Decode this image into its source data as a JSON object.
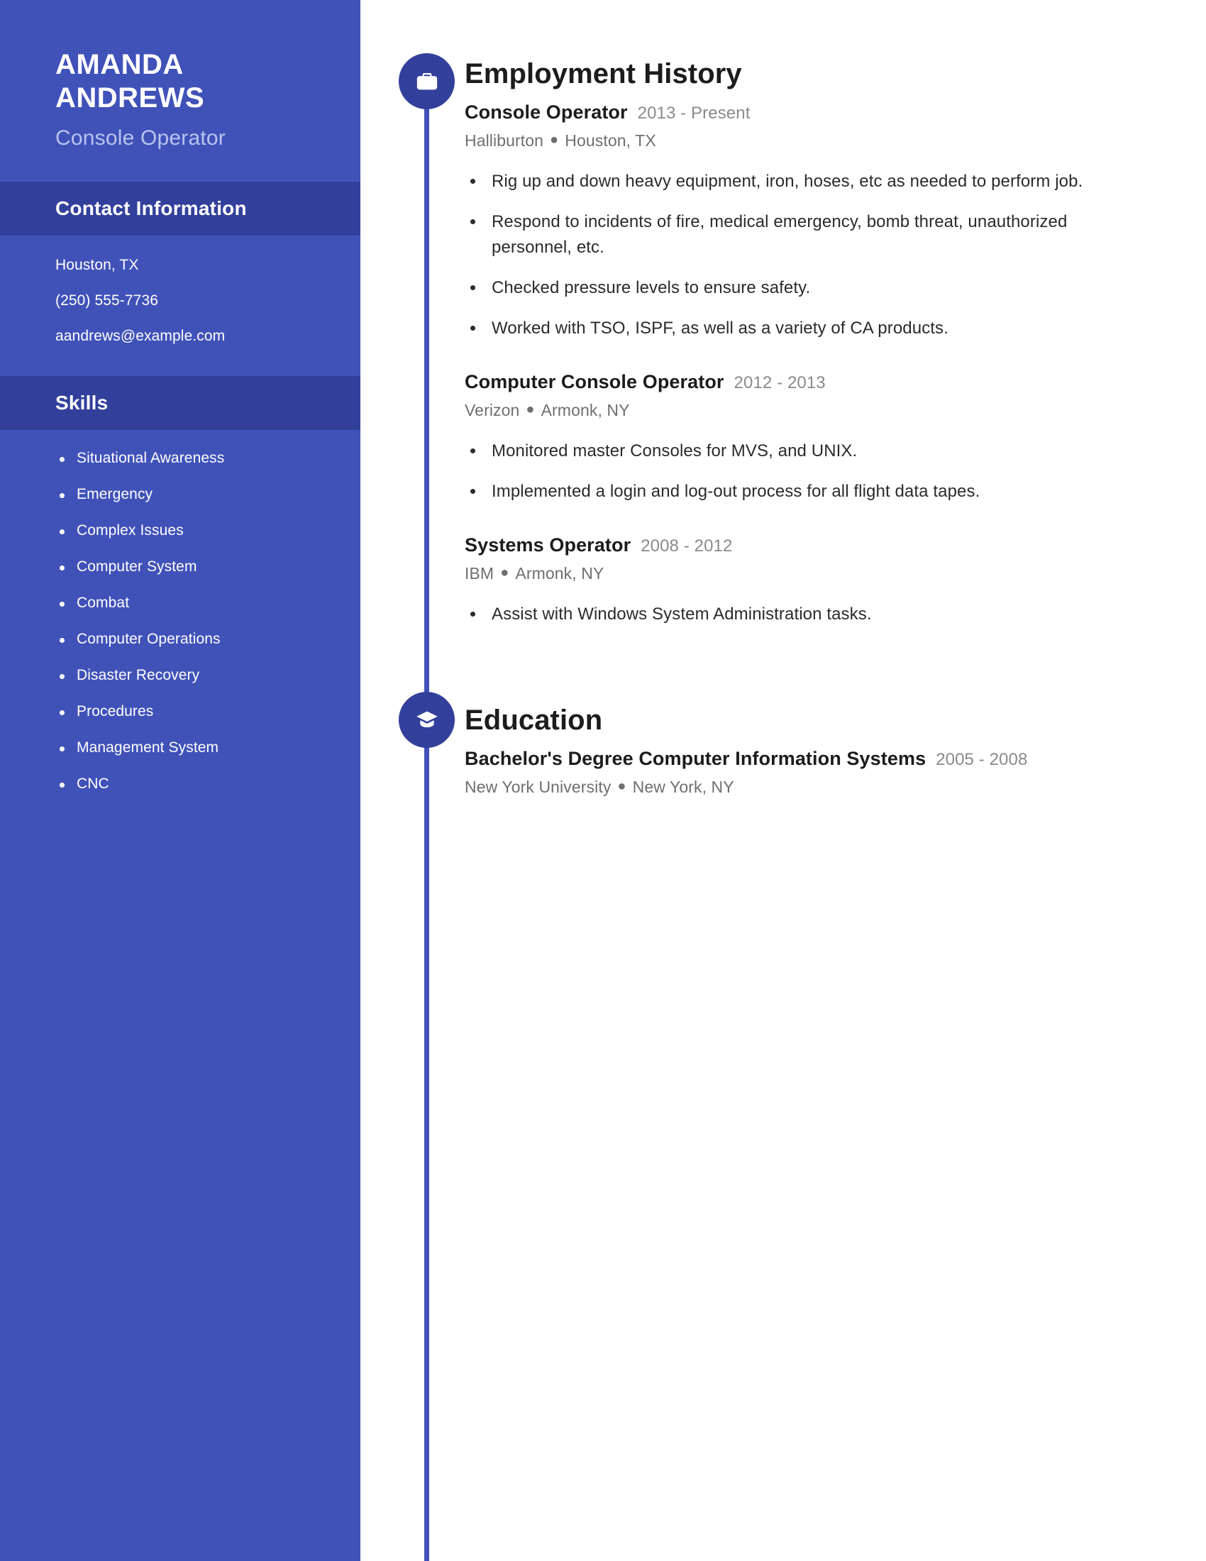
{
  "theme": {
    "sidebar_bg": "#4052b8",
    "band_bg": "#32409b",
    "accent": "#32409b",
    "subtitle_color": "#b9c4ef"
  },
  "sidebar": {
    "name_line1": "AMANDA",
    "name_line2": "ANDREWS",
    "job_title": "Console Operator",
    "contact": {
      "heading": "Contact Information",
      "location": "Houston, TX",
      "phone": "(250) 555-7736",
      "email": "aandrews@example.com"
    },
    "skills": {
      "heading": "Skills",
      "items": [
        "Situational Awareness",
        "Emergency",
        "Complex Issues",
        "Computer System",
        "Combat",
        "Computer Operations",
        "Disaster Recovery",
        "Procedures",
        "Management System",
        "CNC"
      ]
    }
  },
  "main": {
    "employment": {
      "heading": "Employment History",
      "icon": "briefcase-icon",
      "entries": [
        {
          "title": "Console Operator",
          "dates": "2013 - Present",
          "company": "Halliburton",
          "location": "Houston, TX",
          "bullets": [
            "Rig up and down heavy equipment, iron, hoses, etc as needed to perform job.",
            "Respond to incidents of fire, medical emergency, bomb threat, unauthorized personnel, etc.",
            "Checked pressure levels to ensure safety.",
            "Worked with TSO, ISPF, as well as a variety of CA products."
          ]
        },
        {
          "title": "Computer Console Operator",
          "dates": "2012 - 2013",
          "company": "Verizon",
          "location": "Armonk, NY",
          "bullets": [
            "Monitored master Consoles for MVS, and UNIX.",
            "Implemented a login and log-out process for all flight data tapes."
          ]
        },
        {
          "title": "Systems Operator",
          "dates": "2008 - 2012",
          "company": "IBM",
          "location": "Armonk, NY",
          "bullets": [
            "Assist with Windows System Administration tasks."
          ]
        }
      ]
    },
    "education": {
      "heading": "Education",
      "icon": "graduation-cap-icon",
      "entries": [
        {
          "title": "Bachelor's Degree Computer Information Systems",
          "dates": "2005 - 2008",
          "school": "New York University",
          "location": "New York, NY"
        }
      ]
    }
  }
}
